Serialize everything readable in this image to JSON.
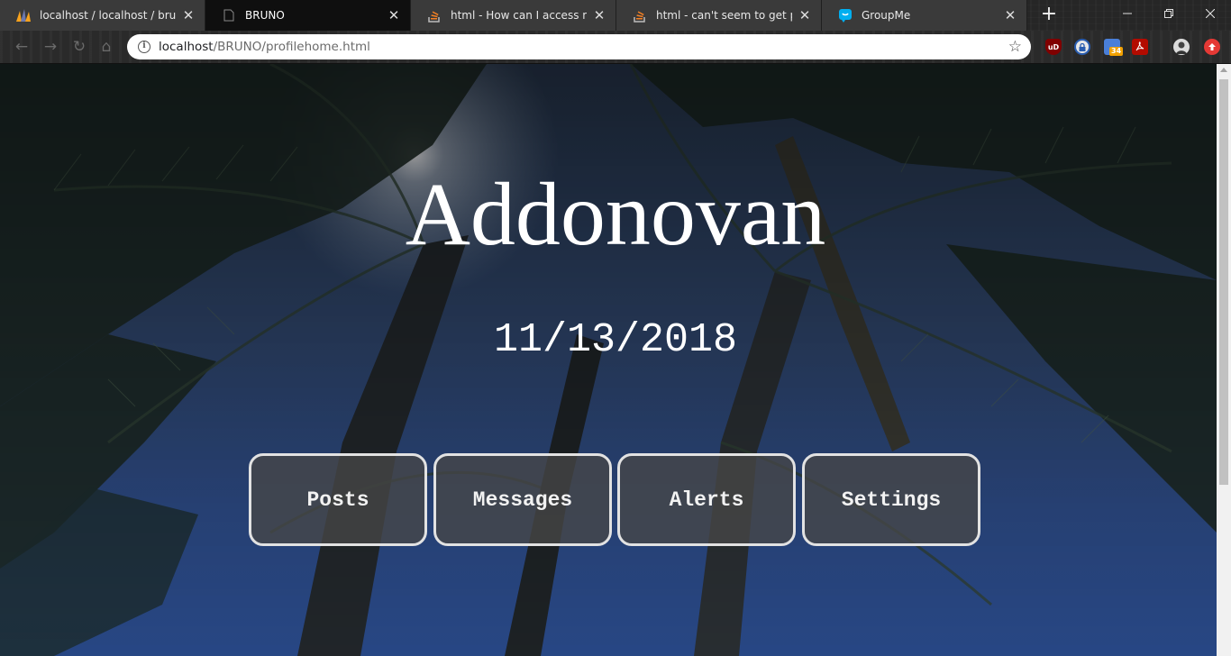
{
  "browser": {
    "tabs": [
      {
        "title": "localhost / localhost / bruno / ",
        "favicon": "phpmyadmin-icon"
      },
      {
        "title": "BRUNO",
        "favicon": "blank-page-icon",
        "active": true
      },
      {
        "title": "html - How can I access my se",
        "favicon": "stackoverflow-icon"
      },
      {
        "title": "html - can't seem to get php w",
        "favicon": "stackoverflow-icon"
      },
      {
        "title": "GroupMe",
        "favicon": "groupme-icon"
      }
    ],
    "address_bar": {
      "host": "localhost",
      "path": "/BRUNO/profilehome.html"
    },
    "extension_badge": "34"
  },
  "page": {
    "name": "Addonovan",
    "date": "11/13/2018",
    "menu": [
      {
        "label": "Posts"
      },
      {
        "label": "Messages"
      },
      {
        "label": "Alerts"
      },
      {
        "label": "Settings"
      }
    ]
  },
  "colors": {
    "sky": "#2d4b86",
    "button_bg": "#464646",
    "button_border": "#e2e2e2",
    "text": "#ffffff"
  }
}
